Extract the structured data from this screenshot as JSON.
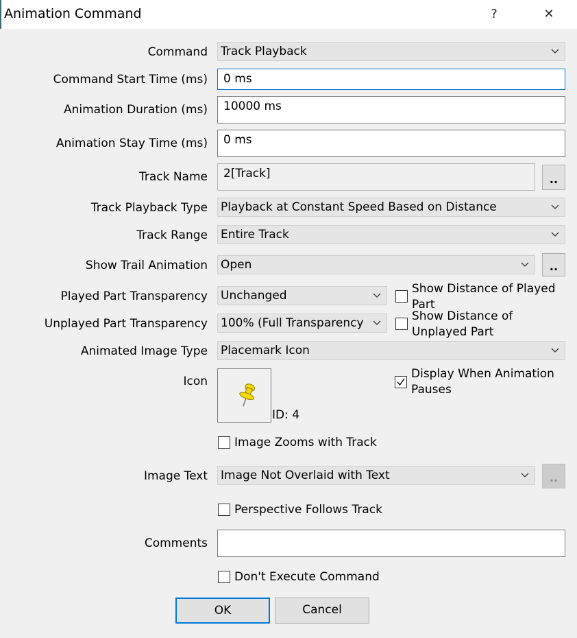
{
  "window": {
    "title": "Animation Command",
    "help_label": "?",
    "close_label": "✕"
  },
  "form": {
    "command": {
      "label": "Command",
      "value": "Track Playback"
    },
    "start_time": {
      "label": "Command Start Time (ms)",
      "value": "0 ms"
    },
    "duration": {
      "label": "Animation Duration (ms)",
      "value": "10000 ms"
    },
    "stay_time": {
      "label": "Animation Stay Time (ms)",
      "value": "0 ms"
    },
    "track_name": {
      "label": "Track Name",
      "value": "2[Track]",
      "browse_label": ".."
    },
    "playback_type": {
      "label": "Track Playback Type",
      "value": "Playback at Constant Speed Based on Distance"
    },
    "track_range": {
      "label": "Track Range",
      "value": "Entire Track"
    },
    "trail_animation": {
      "label": "Show Trail Animation",
      "value": "Open",
      "browse_label": ".."
    },
    "played_transparency": {
      "label": "Played Part Transparency",
      "value": "Unchanged"
    },
    "show_distance_played": {
      "label": "Show Distance of Played Part",
      "checked": false
    },
    "unplayed_transparency": {
      "label": "Unplayed Part Transparency",
      "value": "100% (Full Transparency"
    },
    "show_distance_unplayed": {
      "label": "Show Distance of Unplayed Part",
      "checked": false
    },
    "image_type": {
      "label": "Animated Image Type",
      "value": "Placemark Icon"
    },
    "icon": {
      "label": "Icon",
      "icon_name": "yellow-pushpin-icon",
      "id_text": "ID: 4"
    },
    "display_when_pauses": {
      "label": "Display When Animation Pauses",
      "checked": true
    },
    "image_zooms": {
      "label": "Image Zooms with Track",
      "checked": false
    },
    "image_text": {
      "label": "Image Text",
      "value": "Image Not Overlaid with Text",
      "browse_label": ".."
    },
    "perspective_follows": {
      "label": "Perspective Follows Track",
      "checked": false
    },
    "comments": {
      "label": "Comments",
      "value": ""
    },
    "dont_execute": {
      "label": "Don't Execute Command",
      "checked": false
    }
  },
  "buttons": {
    "ok": "OK",
    "cancel": "Cancel"
  },
  "colors": {
    "focus_border": "#0078d7",
    "pin_yellow": "#f5d800",
    "background": "#f0f0f0"
  }
}
